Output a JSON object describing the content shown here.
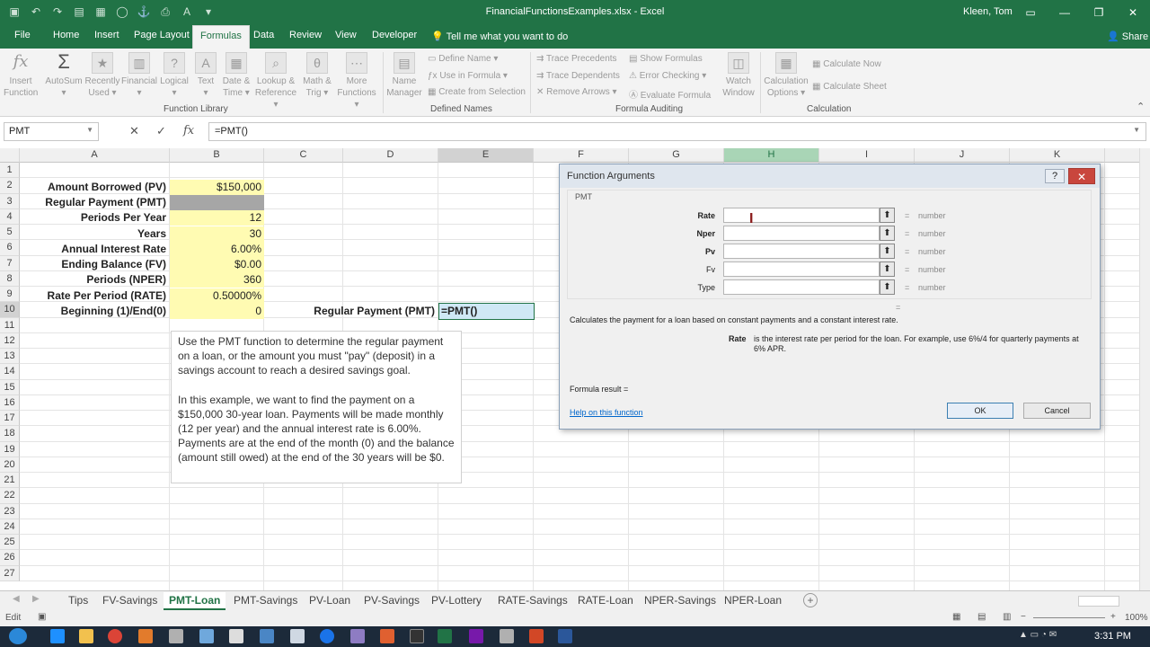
{
  "window": {
    "title": "FinancialFunctionsExamples.xlsx  -  Excel",
    "user": "Kleen, Tom"
  },
  "ribbon_tabs": [
    {
      "label": "File",
      "active": false
    },
    {
      "label": "Home",
      "active": false
    },
    {
      "label": "Insert",
      "active": false
    },
    {
      "label": "Page Layout",
      "active": false
    },
    {
      "label": "Formulas",
      "active": true
    },
    {
      "label": "Data",
      "active": false
    },
    {
      "label": "Review",
      "active": false
    },
    {
      "label": "View",
      "active": false
    },
    {
      "label": "Developer",
      "active": false
    }
  ],
  "tell_me": "Tell me what you want to do",
  "share": "Share",
  "ribbon": {
    "function_library": {
      "label": "Function Library",
      "buttons": [
        {
          "line1": "Insert",
          "line2": "Function",
          "icon": "fx-icon"
        },
        {
          "line1": "AutoSum",
          "line2": "▾",
          "icon": "sigma-icon"
        },
        {
          "line1": "Recently",
          "line2": "Used ▾",
          "icon": "star-icon"
        },
        {
          "line1": "Financial",
          "line2": "▾",
          "icon": "book-icon"
        },
        {
          "line1": "Logical",
          "line2": "▾",
          "icon": "question-icon"
        },
        {
          "line1": "Text",
          "line2": "▾",
          "icon": "text-icon"
        },
        {
          "line1": "Date &",
          "line2": "Time ▾",
          "icon": "calendar-icon"
        },
        {
          "line1": "Lookup &",
          "line2": "Reference ▾",
          "icon": "lookup-icon"
        },
        {
          "line1": "Math &",
          "line2": "Trig ▾",
          "icon": "theta-icon"
        },
        {
          "line1": "More",
          "line2": "Functions ▾",
          "icon": "more-icon"
        }
      ]
    },
    "defined_names": {
      "label": "Defined Names",
      "name_manager": [
        "Name",
        "Manager"
      ],
      "items": [
        "Define Name ▾",
        "Use in Formula ▾",
        "Create from Selection"
      ]
    },
    "formula_auditing": {
      "label": "Formula Auditing",
      "col1": [
        "Trace Precedents",
        "Trace Dependents",
        "Remove Arrows ▾"
      ],
      "col2": [
        "Show Formulas",
        "Error Checking ▾",
        "Evaluate Formula"
      ],
      "watch": [
        "Watch",
        "Window"
      ]
    },
    "calculation": {
      "label": "Calculation",
      "options": [
        "Calculation",
        "Options ▾"
      ],
      "items": [
        "Calculate Now",
        "Calculate Sheet"
      ]
    }
  },
  "formula_bar": {
    "name_box": "PMT",
    "formula": "=PMT()"
  },
  "columns": [
    "A",
    "B",
    "C",
    "D",
    "E",
    "F",
    "G",
    "H",
    "I",
    "J",
    "K"
  ],
  "rows": [
    "1",
    "2",
    "3",
    "4",
    "5",
    "6",
    "7",
    "8",
    "9",
    "10",
    "11",
    "12",
    "13",
    "14",
    "15",
    "16",
    "17",
    "18",
    "19",
    "20",
    "21",
    "22",
    "23",
    "24",
    "25",
    "26",
    "27"
  ],
  "cells": {
    "labels": [
      {
        "row": 2,
        "text": "Amount Borrowed (PV)"
      },
      {
        "row": 3,
        "text": "Regular Payment (PMT)"
      },
      {
        "row": 4,
        "text": "Periods Per Year"
      },
      {
        "row": 5,
        "text": "Years"
      },
      {
        "row": 6,
        "text": "Annual Interest Rate"
      },
      {
        "row": 7,
        "text": "Ending Balance (FV)"
      },
      {
        "row": 8,
        "text": "Periods (NPER)"
      },
      {
        "row": 9,
        "text": "Rate Per Period (RATE)"
      },
      {
        "row": 10,
        "text": "Beginning (1)/End(0)"
      }
    ],
    "values": [
      {
        "row": 2,
        "text": "$150,000"
      },
      {
        "row": 3,
        "text": ""
      },
      {
        "row": 4,
        "text": "12"
      },
      {
        "row": 5,
        "text": "30"
      },
      {
        "row": 6,
        "text": "6.00%"
      },
      {
        "row": 7,
        "text": "$0.00"
      },
      {
        "row": 8,
        "text": "360"
      },
      {
        "row": 9,
        "text": "0.50000%"
      },
      {
        "row": 10,
        "text": "0"
      }
    ],
    "d10": "Regular Payment (PMT)",
    "e10": "=PMT()"
  },
  "comment": {
    "p1": "Use the PMT function to determine the regular payment on a loan, or the amount you must \"pay\" (deposit) in a savings account to reach a desired savings goal.",
    "p2": "In this example, we want to find the payment on a $150,000 30-year loan. Payments will be made monthly (12 per year) and the annual interest rate is 6.00%. Payments are at the end of the month (0) and the balance (amount still owed) at the end of the 30 years will be $0."
  },
  "dialog": {
    "title": "Function Arguments",
    "function": "PMT",
    "args": [
      {
        "name": "Rate",
        "bold": true,
        "eq": "=",
        "type": "number"
      },
      {
        "name": "Nper",
        "bold": true,
        "eq": "=",
        "type": "number"
      },
      {
        "name": "Pv",
        "bold": true,
        "eq": "=",
        "type": "number"
      },
      {
        "name": "Fv",
        "bold": false,
        "eq": "=",
        "type": "number"
      },
      {
        "name": "Type",
        "bold": false,
        "eq": "=",
        "type": "number"
      }
    ],
    "result_eq": "=",
    "description": "Calculates the payment for a loan based on constant payments and a constant interest rate.",
    "arg_name": "Rate",
    "arg_description": "is the interest rate per period for the loan. For example, use 6%/4 for quarterly payments at 6% APR.",
    "formula_result": "Formula result =",
    "help_link": "Help on this function",
    "ok": "OK",
    "cancel": "Cancel"
  },
  "sheet_tabs": [
    {
      "label": "Tips",
      "active": false
    },
    {
      "label": "FV-Savings",
      "active": false
    },
    {
      "label": "PMT-Loan",
      "active": true
    },
    {
      "label": "PMT-Savings",
      "active": false
    },
    {
      "label": "PV-Loan",
      "active": false
    },
    {
      "label": "PV-Savings",
      "active": false
    },
    {
      "label": "PV-Lottery",
      "active": false
    },
    {
      "label": "RATE-Savings",
      "active": false
    },
    {
      "label": "RATE-Loan",
      "active": false
    },
    {
      "label": "NPER-Savings",
      "active": false
    },
    {
      "label": "NPER-Loan",
      "active": false
    }
  ],
  "status": {
    "mode": "Edit",
    "zoom": "100%"
  },
  "taskbar": {
    "time": "3:31 PM"
  }
}
